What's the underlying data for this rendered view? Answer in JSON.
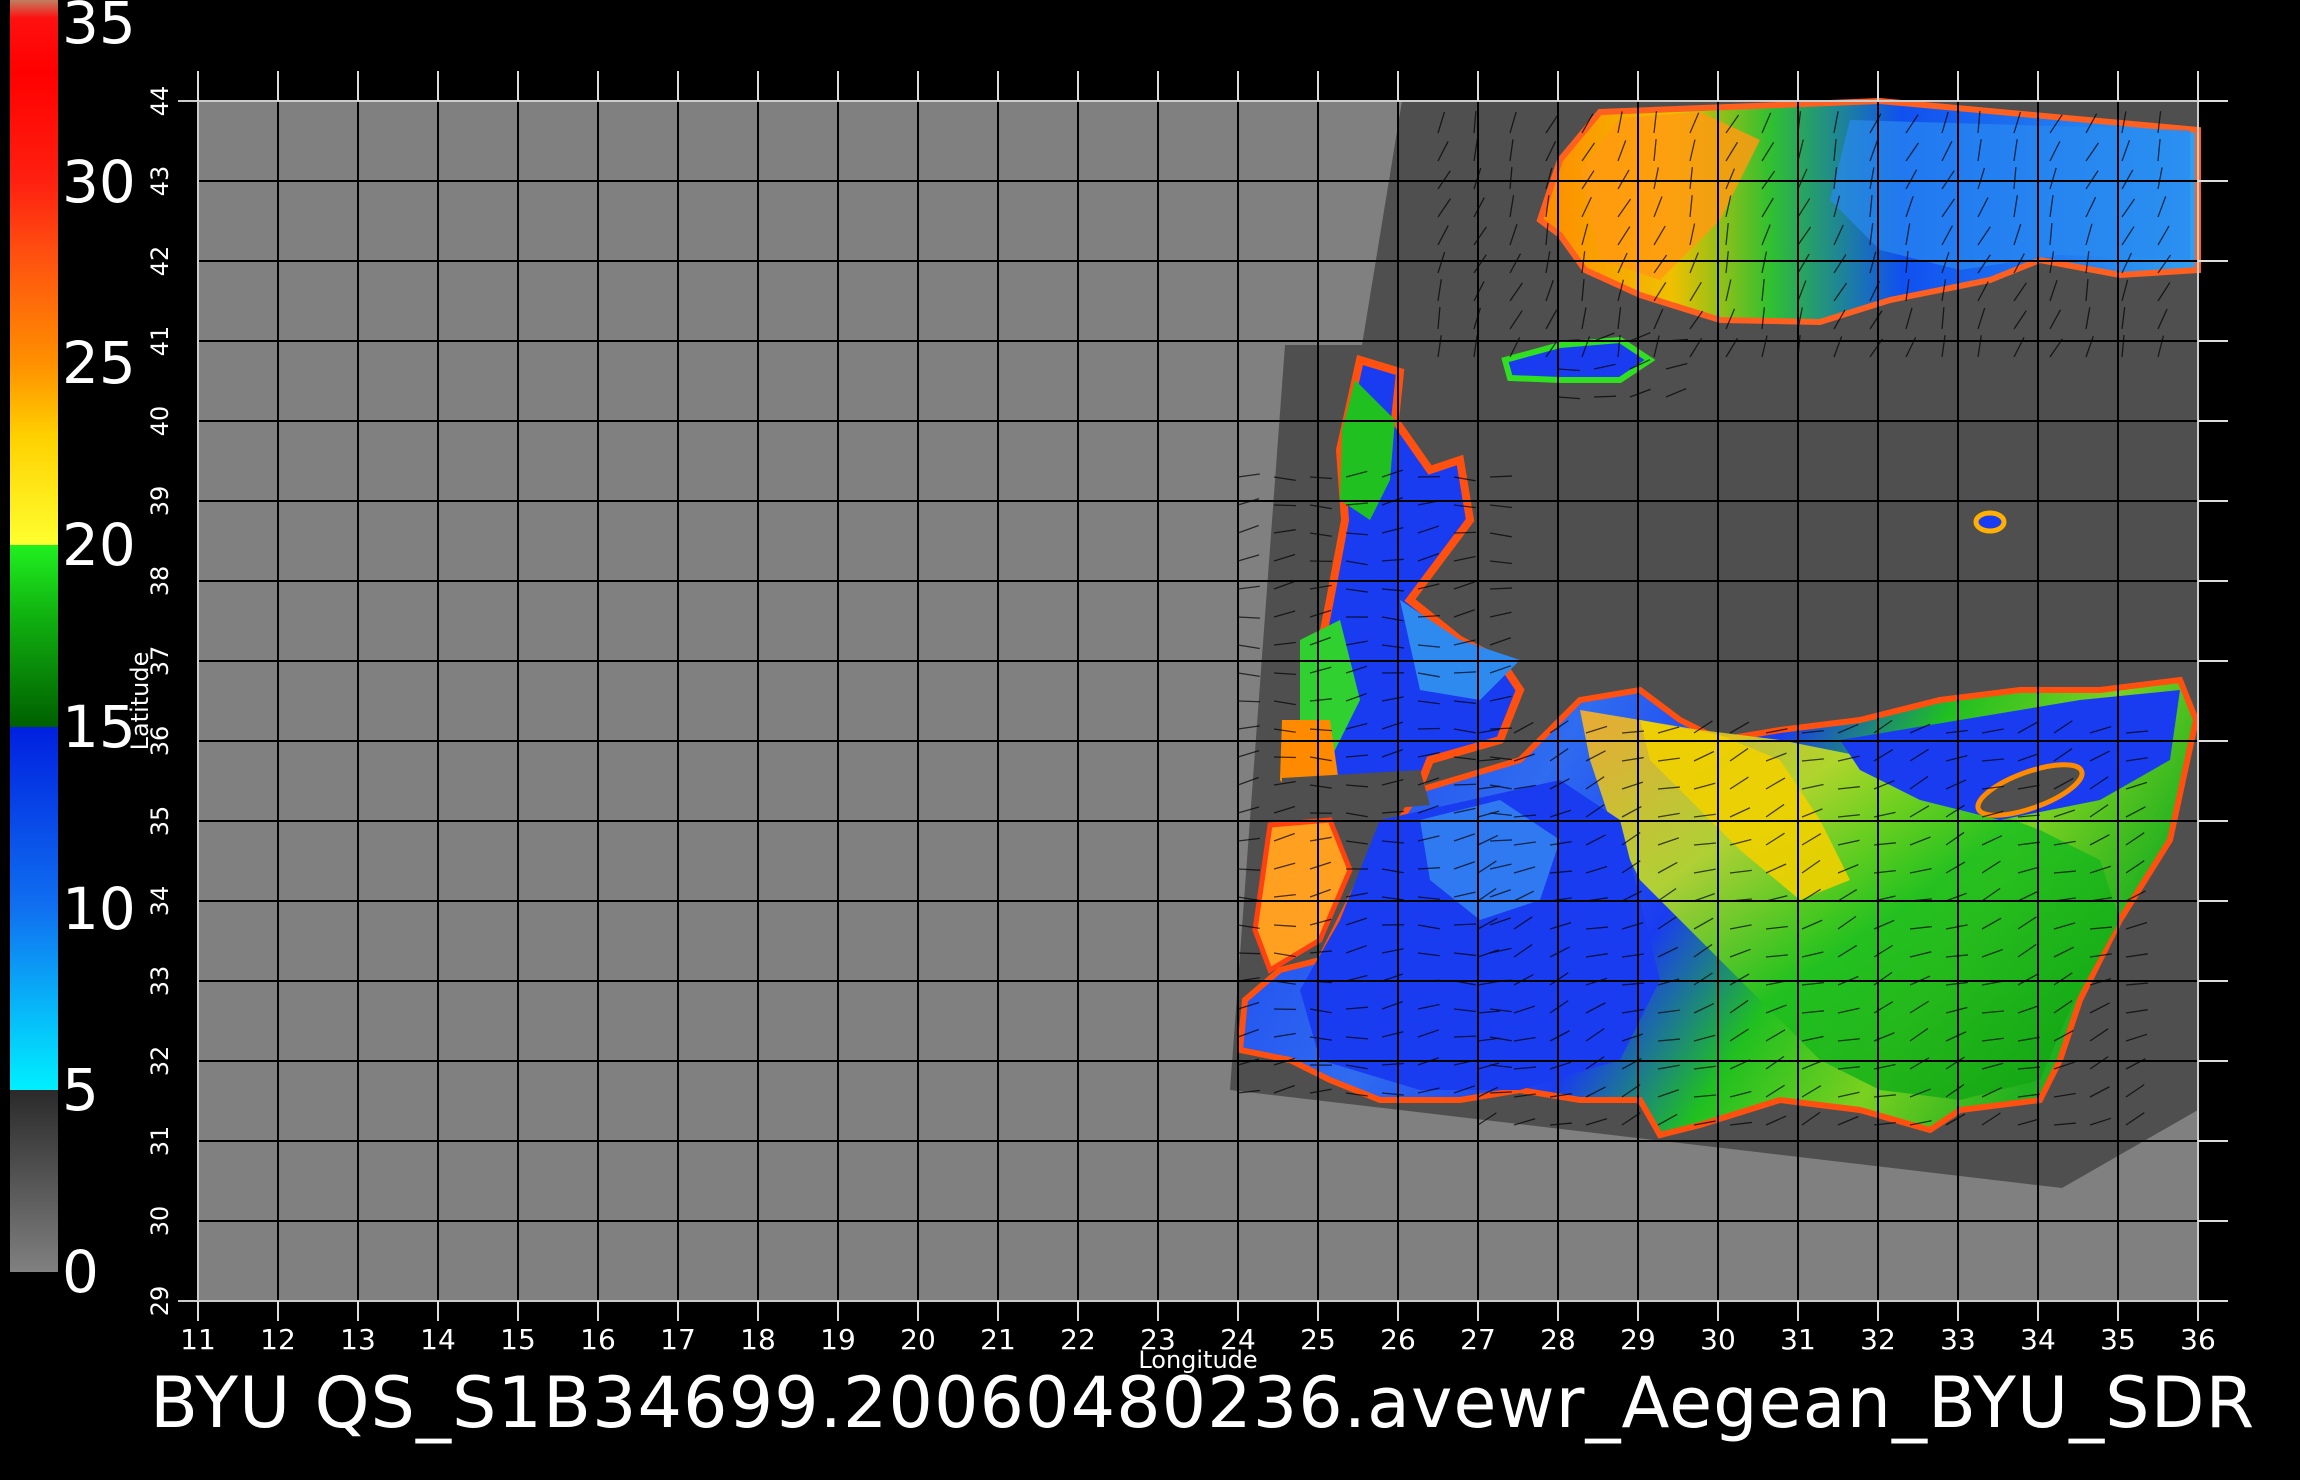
{
  "title": "BYU  QS_S1B34699.20060480236.avewr_Aegean_BYU_SDR",
  "map": {
    "xlabel": "Longitude",
    "ylabel": "Latitude",
    "lon_range": [
      11,
      36
    ],
    "lat_range": [
      29,
      44
    ],
    "lon_ticks": [
      11,
      12,
      13,
      14,
      15,
      16,
      17,
      18,
      19,
      20,
      21,
      22,
      23,
      24,
      25,
      26,
      27,
      28,
      29,
      30,
      31,
      32,
      33,
      34,
      35,
      36
    ],
    "lat_ticks": [
      29,
      30,
      31,
      32,
      33,
      34,
      35,
      36,
      37,
      38,
      39,
      40,
      41,
      42,
      43,
      44
    ],
    "grid": true,
    "no_data_color": "#808080",
    "land_color": "#4f4f4f",
    "vector_color": "#000000"
  },
  "colorbar": {
    "range": [
      0,
      35
    ],
    "labels": [
      "35",
      "30",
      "25",
      "20",
      "15",
      "10",
      "5",
      "0"
    ],
    "label_values": [
      35,
      30,
      25,
      20,
      15,
      10,
      5,
      0
    ],
    "stops": [
      {
        "value": 0,
        "color": "#808080"
      },
      {
        "value": 5,
        "color": "#2a2a2a"
      },
      {
        "value": 5,
        "color": "#00f0ff"
      },
      {
        "value": 10,
        "color": "#1070f0"
      },
      {
        "value": 15,
        "color": "#0020e0"
      },
      {
        "value": 15,
        "color": "#006000"
      },
      {
        "value": 18,
        "color": "#10b010"
      },
      {
        "value": 20,
        "color": "#20f020"
      },
      {
        "value": 20,
        "color": "#ffff30"
      },
      {
        "value": 23,
        "color": "#ffd000"
      },
      {
        "value": 25,
        "color": "#ff9000"
      },
      {
        "value": 28,
        "color": "#ff5010"
      },
      {
        "value": 30,
        "color": "#ff2010"
      },
      {
        "value": 33,
        "color": "#ff0000"
      },
      {
        "value": 34.5,
        "color": "#ff1010"
      },
      {
        "value": 35,
        "color": "#c08060"
      }
    ]
  }
}
